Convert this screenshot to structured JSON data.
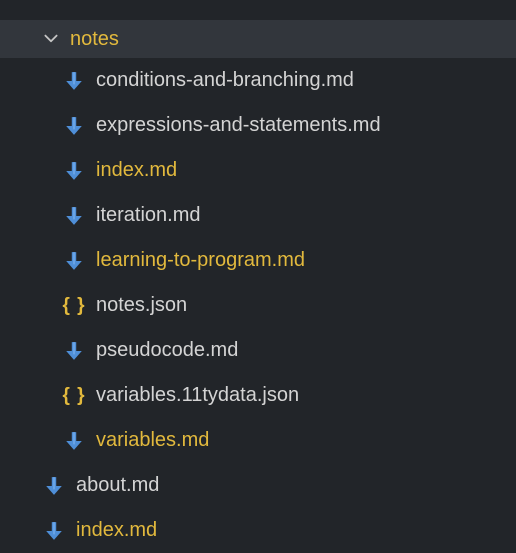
{
  "folder": {
    "name": "notes",
    "expanded": true
  },
  "children": [
    {
      "label": "conditions-and-branching.md",
      "icon": "markdown",
      "modified": false
    },
    {
      "label": "expressions-and-statements.md",
      "icon": "markdown",
      "modified": false
    },
    {
      "label": "index.md",
      "icon": "markdown",
      "modified": true
    },
    {
      "label": "iteration.md",
      "icon": "markdown",
      "modified": false
    },
    {
      "label": "learning-to-program.md",
      "icon": "markdown",
      "modified": true
    },
    {
      "label": "notes.json",
      "icon": "json",
      "modified": false
    },
    {
      "label": "pseudocode.md",
      "icon": "markdown",
      "modified": false
    },
    {
      "label": "variables.11tydata.json",
      "icon": "json",
      "modified": false
    },
    {
      "label": "variables.md",
      "icon": "markdown",
      "modified": true
    }
  ],
  "siblings": [
    {
      "label": "about.md",
      "icon": "markdown",
      "modified": false
    },
    {
      "label": "index.md",
      "icon": "markdown",
      "modified": true
    }
  ],
  "colors": {
    "bg": "#222529",
    "rowBg": "#32363c",
    "text": "#d4d4d4",
    "modified": "#e2b93d",
    "iconBlue": "#4f8fd8"
  }
}
